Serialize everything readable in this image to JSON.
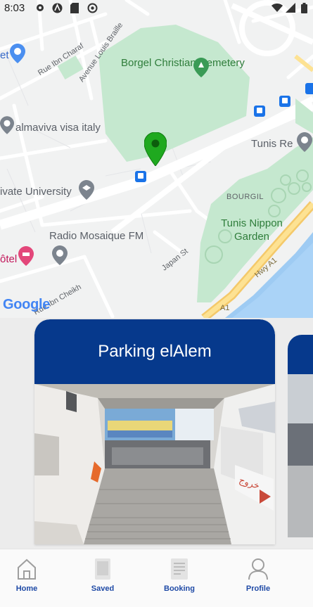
{
  "status_bar": {
    "time": "8:03",
    "left_icons": [
      "settings-icon",
      "a-icon",
      "sd-card-icon",
      "at-icon"
    ],
    "right_icons": [
      "wifi-icon",
      "signal-icon",
      "battery-icon"
    ]
  },
  "map": {
    "labels": {
      "cemetery": "Borgel Christian Cemetery",
      "visa": "almaviva visa italy",
      "tunis_re": "Tunis Re",
      "university": "ivate University",
      "radio": "Radio Mosaique FM",
      "hotel": "ôtel",
      "garden": "Tunis Nippon Garden",
      "bourgil": "BOURGIL",
      "rue_ibn_charaf": "Rue Ibn Charaf",
      "avenue_louis_braille": "Avenue Louis Braille",
      "japan_st": "Japan St",
      "hwy_a1": "Hwy A1",
      "a1": "A1",
      "rue_ibn_cheikh": "Rue Ibn Cheikh"
    },
    "attribution": "Google",
    "marker_color": "#1fa91f"
  },
  "cards": [
    {
      "title": "Parking elAlem"
    }
  ],
  "nav": {
    "items": [
      {
        "label": "Home",
        "icon": "home-icon"
      },
      {
        "label": "Saved",
        "icon": "saved-icon"
      },
      {
        "label": "Booking",
        "icon": "booking-icon"
      },
      {
        "label": "Profile",
        "icon": "profile-icon"
      }
    ],
    "accent": "#1f4aa6"
  }
}
